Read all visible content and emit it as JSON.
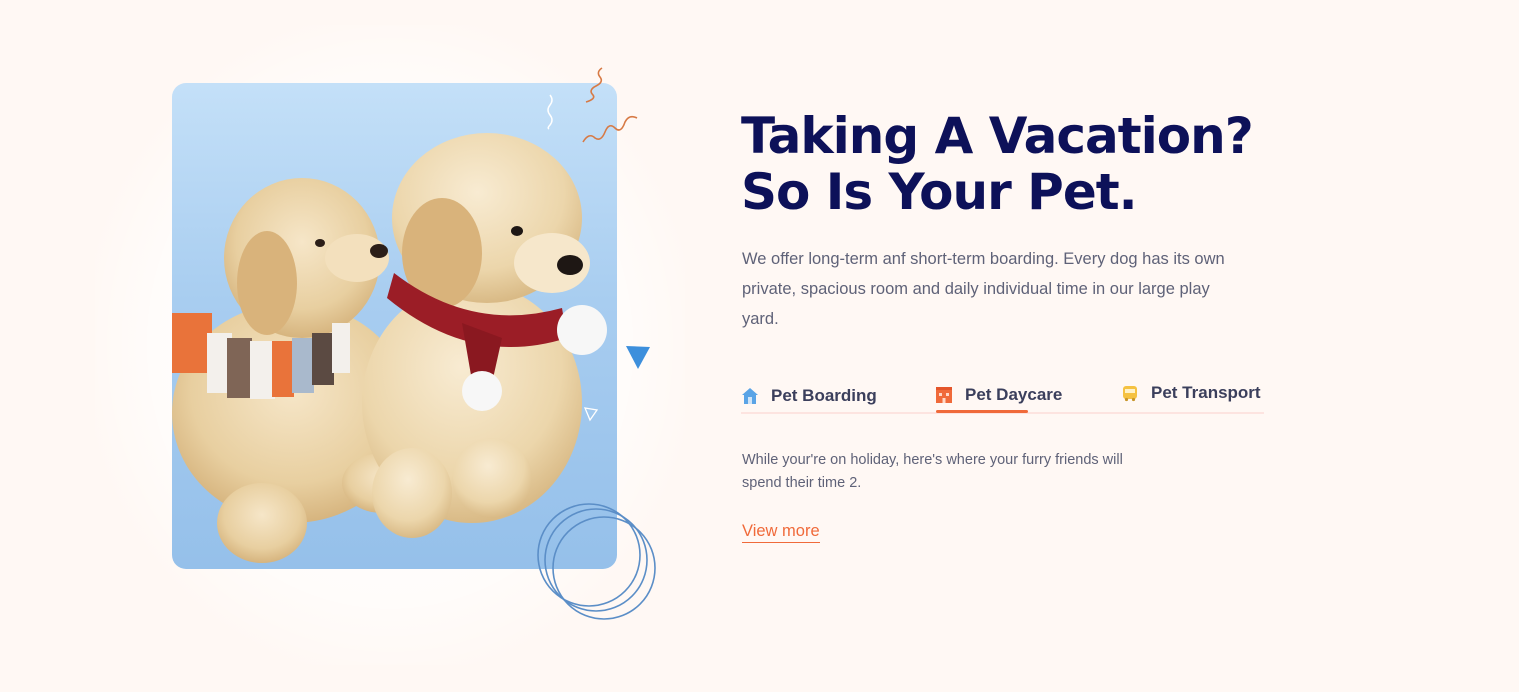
{
  "hero": {
    "heading_line1": "Taking A Vacation?",
    "heading_line2": "So Is Your Pet.",
    "intro": "We offer long-term anf short-term boarding. Every dog has its own private, spacious room and daily individual time in our large play yard."
  },
  "tabs": [
    {
      "label": "Pet Boarding",
      "icon": "house-icon",
      "icon_color": "#5aa4e6",
      "active": false
    },
    {
      "label": "Pet Daycare",
      "icon": "building-icon",
      "icon_color": "#f06a3a",
      "active": true
    },
    {
      "label": "Pet Transport",
      "icon": "bus-icon",
      "icon_color": "#f5c242",
      "active": false
    }
  ],
  "tab_content": {
    "text": "While your're on holiday, here's where your furry friends will spend their time 2.",
    "link_label": "View more"
  },
  "colors": {
    "heading": "#0d1159",
    "accent": "#f06a3a",
    "background": "#fff8f4",
    "card_blue": "#a8cdf0"
  }
}
